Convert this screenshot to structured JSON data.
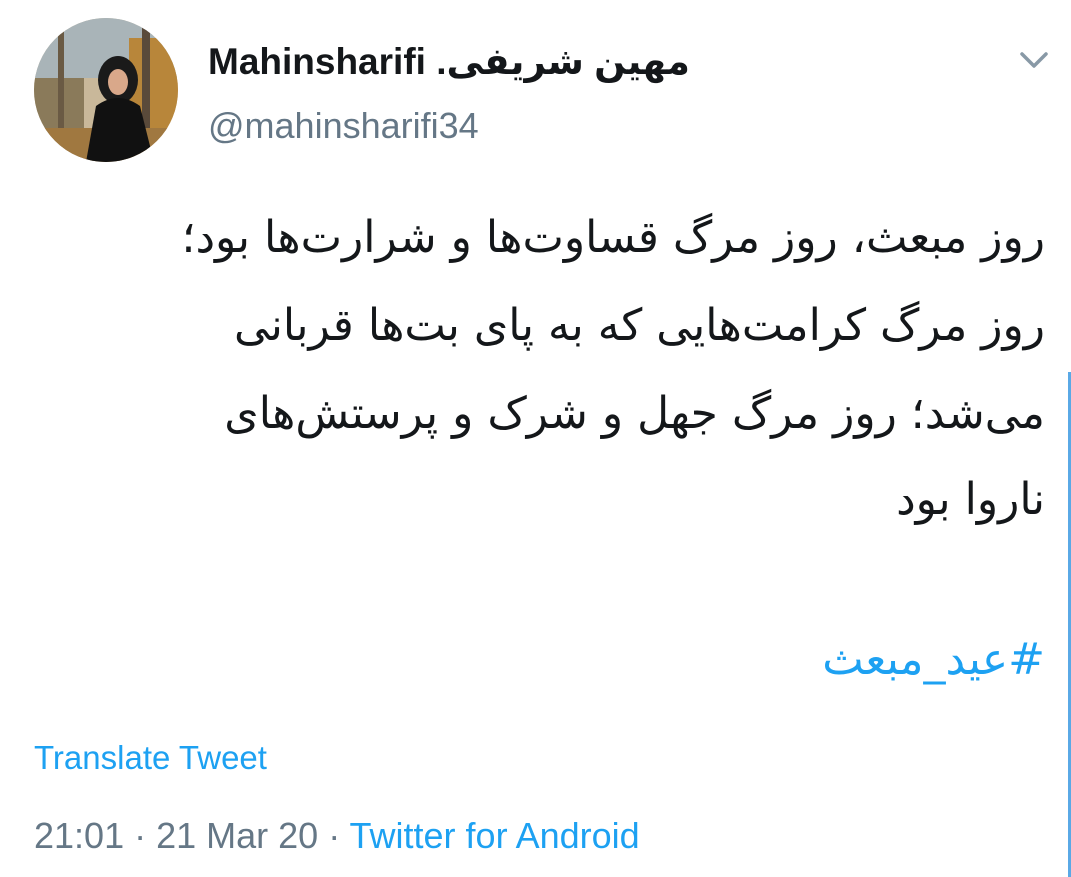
{
  "user": {
    "display_name": "Mahinsharifi .مهین شریفی",
    "handle": "@mahinsharifi34"
  },
  "icons": {
    "avatar": "profile-photo",
    "menu": "chevron-down-icon"
  },
  "tweet": {
    "lines": [
      "روز مبعث، روز مرگ قساوت‌ها و شرارت‌ها بود؛",
      "روز مرگ کرامت‌هایی که به پای بت‌ها قربانی",
      "می‌شد؛ روز مرگ جهل و شرک و پرستش‌های",
      "ناروا بود"
    ],
    "hashtag": "#عید_مبعث"
  },
  "translate_label": "Translate Tweet",
  "meta": {
    "time": "21:01",
    "date": "21 Mar 20",
    "separator": " · ",
    "source": "Twitter for Android"
  },
  "colors": {
    "link": "#1da1f2",
    "secondary_text": "#657786",
    "primary_text": "#14171a"
  }
}
